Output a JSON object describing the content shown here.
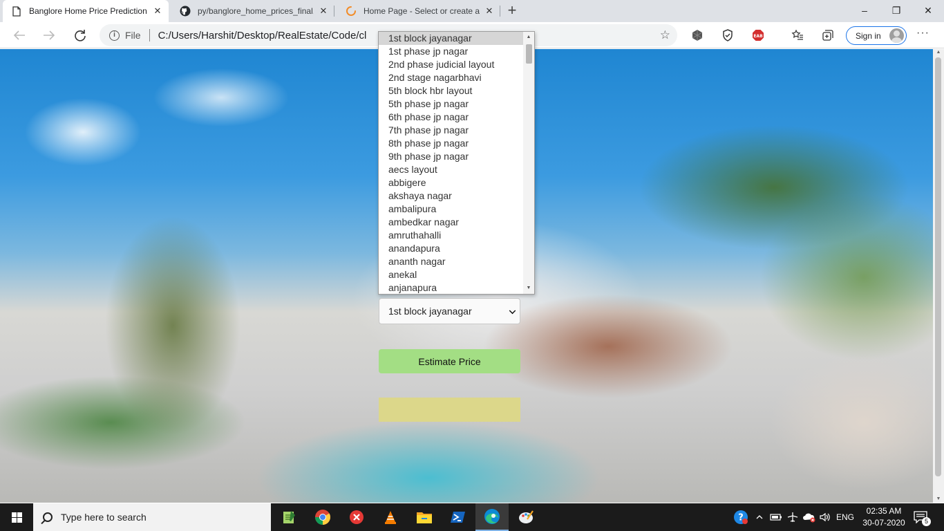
{
  "browser": {
    "tabs": [
      {
        "title": "Banglore Home Price Prediction",
        "icon": "page-icon",
        "active": true
      },
      {
        "title": "py/banglore_home_prices_final.ip",
        "icon": "github-icon",
        "active": false
      },
      {
        "title": "Home Page - Select or create a n",
        "icon": "loading-spinner-icon",
        "active": false
      }
    ],
    "close_glyph": "✕",
    "new_tab_glyph": "+",
    "window_controls": {
      "minimize": "–",
      "restore": "❐",
      "close": "✕"
    },
    "address_bar": {
      "scheme_label": "File",
      "url": "C:/Users/Harshit/Desktop/RealEstate/Code/cl"
    },
    "signin_label": "Sign in",
    "more_glyph": "···"
  },
  "page": {
    "location_dropdown": {
      "selected": "1st block jayanagar",
      "options": [
        "1st block jayanagar",
        "1st phase jp nagar",
        "2nd phase judicial layout",
        "2nd stage nagarbhavi",
        "5th block hbr layout",
        "5th phase jp nagar",
        "6th phase jp nagar",
        "7th phase jp nagar",
        "8th phase jp nagar",
        "9th phase jp nagar",
        "aecs layout",
        "abbigere",
        "akshaya nagar",
        "ambalipura",
        "ambedkar nagar",
        "amruthahalli",
        "anandapura",
        "ananth nagar",
        "anekal",
        "anjanapura"
      ]
    },
    "estimate_button": "Estimate Price",
    "result_text": ""
  },
  "taskbar": {
    "search_placeholder": "Type here to search",
    "apps": [
      "notepad-icon",
      "chrome-icon",
      "anydesk-icon",
      "vlc-icon",
      "file-explorer-icon",
      "powershell-icon",
      "edge-icon",
      "paint-icon"
    ],
    "language": "ENG",
    "time": "02:35 AM",
    "date": "30-07-2020",
    "notification_count": "5"
  },
  "colors": {
    "estimate_button": "#a3de84",
    "result_box": "#dcd78a",
    "signin_border": "#1a73e8",
    "taskbar": "#1b1b1b"
  }
}
